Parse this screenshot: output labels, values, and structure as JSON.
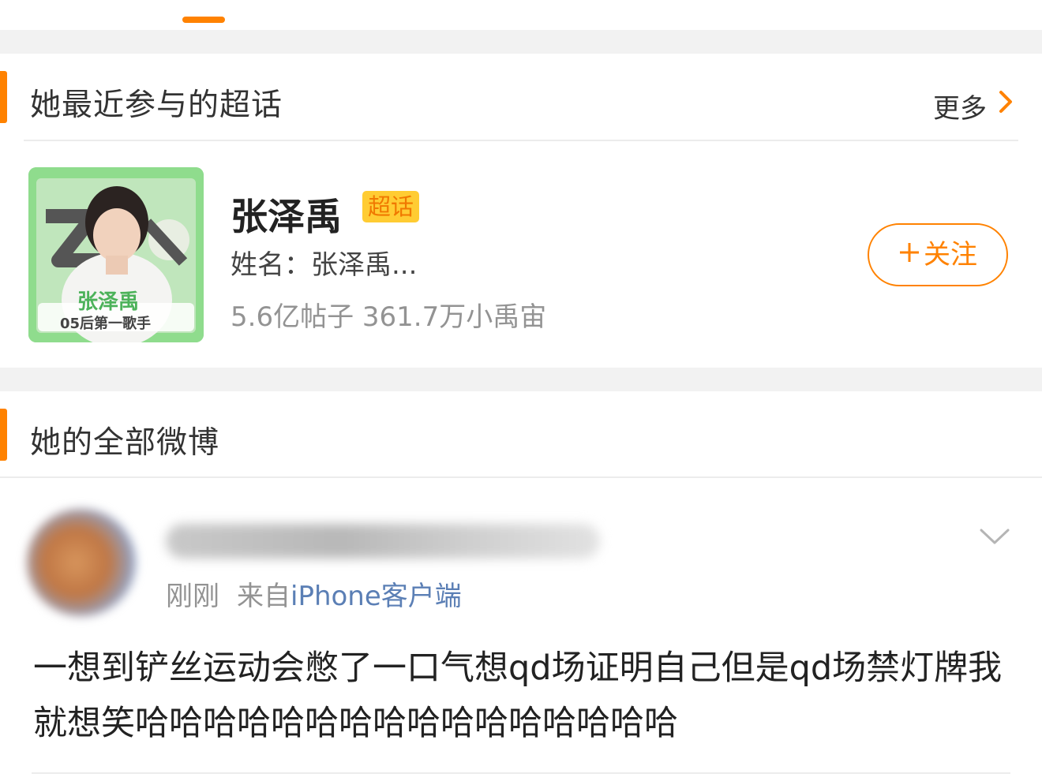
{
  "colors": {
    "accent": "#ff8200",
    "link": "#5b7fb5",
    "badge_bg": "#ffcc33"
  },
  "supertopics_section": {
    "title": "她最近参与的超话",
    "more_label": "更多",
    "more_icon": "chevron-right-icon",
    "topic": {
      "name": "张泽禹",
      "badge": "超话",
      "desc": "姓名：张泽禹...",
      "stats": "5.6亿帖子 361.7万小禹宙",
      "cover_text_line1": "张泽禹",
      "cover_text_line2": "05后第一歌手",
      "follow_label": "关注",
      "follow_icon": "plus-icon"
    }
  },
  "weibo_section": {
    "title": "她的全部微博"
  },
  "post": {
    "time": "刚刚",
    "from_prefix": "来自",
    "client": "iPhone客户端",
    "menu_icon": "chevron-down-icon",
    "text": "一想到铲丝运动会憋了一口气想qd场证明自己但是qd场禁灯牌我就想笑哈哈哈哈哈哈哈哈哈哈哈哈哈哈哈哈"
  }
}
